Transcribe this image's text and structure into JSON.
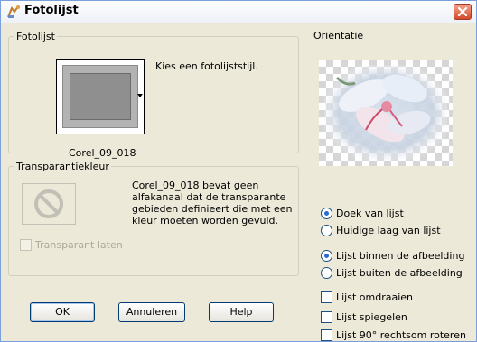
{
  "window": {
    "title": "Fotolijst",
    "close_label": "×"
  },
  "frame_group": {
    "label": "Fotolijst",
    "hint": "Kies een fotolijststijl.",
    "frame_name": "Corel_09_018"
  },
  "transparency_group": {
    "label": "Transparantiekleur",
    "message": [
      "Corel_09_018 bevat geen",
      "alfakanaal dat de transparante",
      "gebieden definieert die met een",
      "kleur moeten worden gevuld."
    ],
    "checkbox_label": "Transparant laten",
    "checkbox_checked": false,
    "checkbox_enabled": false
  },
  "orientation_group": {
    "label": "Oriëntatie",
    "radios_target": [
      {
        "label": "Doek van lijst",
        "selected": true
      },
      {
        "label": "Huidige laag van lijst",
        "selected": false
      }
    ],
    "radios_position": [
      {
        "label": "Lijst binnen de afbeelding",
        "selected": true
      },
      {
        "label": "Lijst buiten de afbeelding",
        "selected": false
      }
    ],
    "checkboxes": [
      {
        "label": "Lijst omdraaien",
        "checked": false
      },
      {
        "label": "Lijst spiegelen",
        "checked": false
      },
      {
        "label": "Lijst 90° rechtsom roteren",
        "checked": false
      }
    ]
  },
  "buttons": {
    "ok": "OK",
    "cancel": "Annuleren",
    "help": "Help"
  },
  "icons": {
    "app": "frame-app-icon",
    "close": "close-icon",
    "no": "no-symbol-icon",
    "dropdown": "dropdown-arrow-icon"
  },
  "colors": {
    "title_bar": "#eef1f7",
    "close_button": "#d5482b",
    "window_border": "#7aa0dc",
    "dialog_bg": "#ece9d8",
    "radio_dot": "#2b6ad6"
  }
}
